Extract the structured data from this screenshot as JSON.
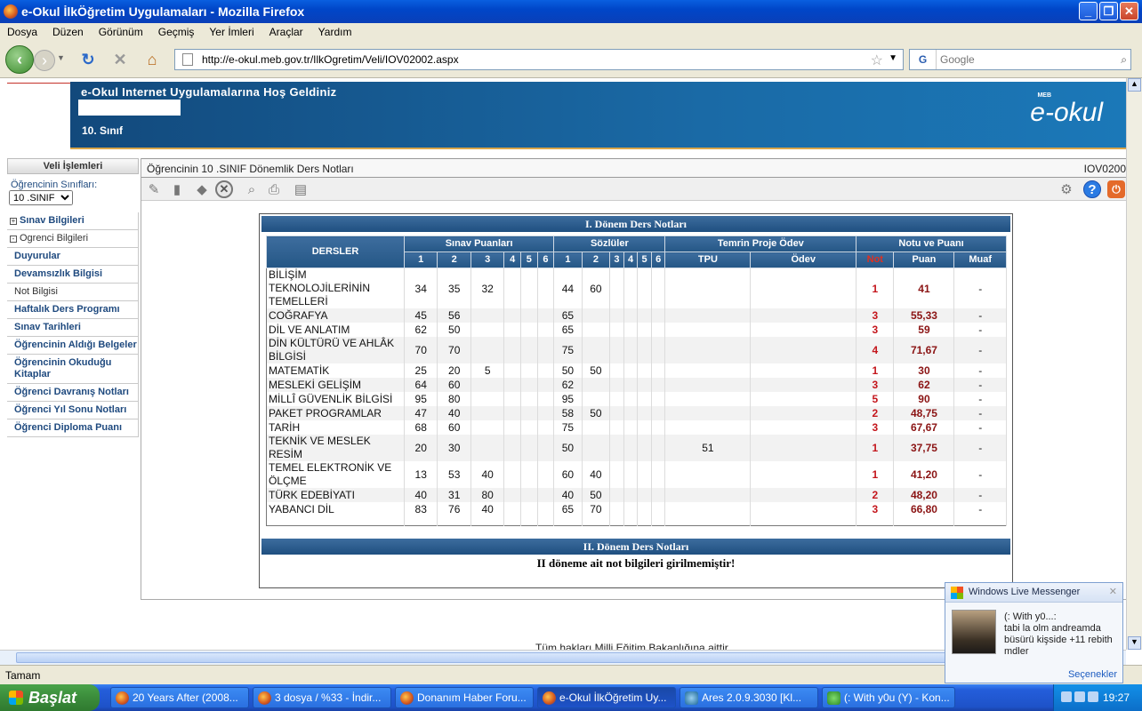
{
  "window": {
    "title": "e-Okul İlkÖğretim Uygulamaları - Mozilla Firefox"
  },
  "menu": [
    "Dosya",
    "Düzen",
    "Görünüm",
    "Geçmiş",
    "Yer İmleri",
    "Araçlar",
    "Yardım"
  ],
  "nav": {
    "url": "http://e-okul.meb.gov.tr/IlkOgretim/Veli/IOV02002.aspx",
    "search_placeholder": "Google",
    "search_engine": "G"
  },
  "banner": {
    "welcome": "e-Okul Internet Uygulamalarına Hoş Geldiniz",
    "grade": "10. Sınıf",
    "logo": "e-okul",
    "meb": "MEB"
  },
  "sidebar": {
    "header": "Veli İşlemleri",
    "class_label": "Öğrencinin Sınıfları:",
    "class_value": "10 .SINIF",
    "sections": [
      "Sınav Bilgileri",
      "Ogrenci Bilgileri"
    ],
    "items": [
      "Duyurular",
      "Devamsızlık Bilgisi",
      "Not Bilgisi",
      "Haftalık Ders Programı",
      "Sınav Tarihleri",
      "Öğrencinin Aldığı Belgeler",
      "Öğrencinin Okuduğu Kitaplar",
      "Öğrenci Davranış Notları",
      "Öğrenci Yıl Sonu Notları",
      "Öğrenci Diploma Puanı"
    ]
  },
  "panel": {
    "title": "Öğrencinin  10 .SINIF  Dönemlik Ders Notları",
    "code": "IOV0200"
  },
  "term1": {
    "title": "I. Dönem Ders Notları",
    "headers": {
      "subjects": "DERSLER",
      "exams": "Sınav Puanları",
      "oral": "Sözlüler",
      "project": "Temrin Proje Ödev",
      "grade": "Notu ve Puanı",
      "tpu": "TPU",
      "odev": "Ödev",
      "not": "Not",
      "puan": "Puan",
      "muaf": "Muaf"
    },
    "exam_cols": [
      "1",
      "2",
      "3",
      "4",
      "5",
      "6"
    ],
    "oral_cols": [
      "1",
      "2",
      "3",
      "4",
      "5",
      "6"
    ],
    "rows": [
      {
        "name": "BİLİŞİM TEKNOLOJİLERİNİN TEMELLERİ",
        "e": [
          "34",
          "35",
          "32",
          "",
          "",
          ""
        ],
        "o": [
          "44",
          "60",
          "",
          "",
          "",
          ""
        ],
        "tpu": "",
        "odev": "",
        "not": "1",
        "puan": "41",
        "muaf": "-"
      },
      {
        "name": "COĞRAFYA",
        "e": [
          "45",
          "56",
          "",
          "",
          "",
          ""
        ],
        "o": [
          "65",
          "",
          "",
          "",
          "",
          ""
        ],
        "tpu": "",
        "odev": "",
        "not": "3",
        "puan": "55,33",
        "muaf": "-"
      },
      {
        "name": "DİL VE ANLATIM",
        "e": [
          "62",
          "50",
          "",
          "",
          "",
          ""
        ],
        "o": [
          "65",
          "",
          "",
          "",
          "",
          ""
        ],
        "tpu": "",
        "odev": "",
        "not": "3",
        "puan": "59",
        "muaf": "-"
      },
      {
        "name": "DİN KÜLTÜRÜ VE AHLÂK BİLGİSİ",
        "e": [
          "70",
          "70",
          "",
          "",
          "",
          ""
        ],
        "o": [
          "75",
          "",
          "",
          "",
          "",
          ""
        ],
        "tpu": "",
        "odev": "",
        "not": "4",
        "puan": "71,67",
        "muaf": "-"
      },
      {
        "name": "MATEMATİK",
        "e": [
          "25",
          "20",
          "5",
          "",
          "",
          ""
        ],
        "o": [
          "50",
          "50",
          "",
          "",
          "",
          ""
        ],
        "tpu": "",
        "odev": "",
        "not": "1",
        "puan": "30",
        "muaf": "-"
      },
      {
        "name": "MESLEKİ GELİŞİM",
        "e": [
          "64",
          "60",
          "",
          "",
          "",
          ""
        ],
        "o": [
          "62",
          "",
          "",
          "",
          "",
          ""
        ],
        "tpu": "",
        "odev": "",
        "not": "3",
        "puan": "62",
        "muaf": "-"
      },
      {
        "name": "MİLLÎ GÜVENLİK BİLGİSİ",
        "e": [
          "95",
          "80",
          "",
          "",
          "",
          ""
        ],
        "o": [
          "95",
          "",
          "",
          "",
          "",
          ""
        ],
        "tpu": "",
        "odev": "",
        "not": "5",
        "puan": "90",
        "muaf": "-"
      },
      {
        "name": "PAKET PROGRAMLAR",
        "e": [
          "47",
          "40",
          "",
          "",
          "",
          ""
        ],
        "o": [
          "58",
          "50",
          "",
          "",
          "",
          ""
        ],
        "tpu": "",
        "odev": "",
        "not": "2",
        "puan": "48,75",
        "muaf": "-"
      },
      {
        "name": "TARİH",
        "e": [
          "68",
          "60",
          "",
          "",
          "",
          ""
        ],
        "o": [
          "75",
          "",
          "",
          "",
          "",
          ""
        ],
        "tpu": "",
        "odev": "",
        "not": "3",
        "puan": "67,67",
        "muaf": "-"
      },
      {
        "name": "TEKNİK VE MESLEK RESİM",
        "e": [
          "20",
          "30",
          "",
          "",
          "",
          ""
        ],
        "o": [
          "50",
          "",
          "",
          "",
          "",
          ""
        ],
        "tpu": "51",
        "odev": "",
        "not": "1",
        "puan": "37,75",
        "muaf": "-"
      },
      {
        "name": "TEMEL ELEKTRONİK VE ÖLÇME",
        "e": [
          "13",
          "53",
          "40",
          "",
          "",
          ""
        ],
        "o": [
          "60",
          "40",
          "",
          "",
          "",
          ""
        ],
        "tpu": "",
        "odev": "",
        "not": "1",
        "puan": "41,20",
        "muaf": "-"
      },
      {
        "name": "TÜRK EDEBİYATI",
        "e": [
          "40",
          "31",
          "80",
          "",
          "",
          ""
        ],
        "o": [
          "40",
          "50",
          "",
          "",
          "",
          ""
        ],
        "tpu": "",
        "odev": "",
        "not": "2",
        "puan": "48,20",
        "muaf": "-"
      },
      {
        "name": "YABANCI DİL",
        "e": [
          "83",
          "76",
          "40",
          "",
          "",
          ""
        ],
        "o": [
          "65",
          "70",
          "",
          "",
          "",
          ""
        ],
        "tpu": "",
        "odev": "",
        "not": "3",
        "puan": "66,80",
        "muaf": "-"
      }
    ]
  },
  "term2": {
    "title": "II. Dönem Ders Notları",
    "message": "II döneme ait not bilgileri girilmemiştir!"
  },
  "footer": "Tüm hakları Milli Eğitim Bakanlığına aittir",
  "status": "Tamam",
  "messenger": {
    "title": "Windows Live Messenger",
    "sender": "(: With y0...:",
    "message": "tabi la olm andreamda büsürü kişside +11 rebith mdler",
    "options": "Seçenekler"
  },
  "taskbar": {
    "start": "Başlat",
    "tasks": [
      {
        "label": "20 Years After (2008...",
        "icon": "firefox"
      },
      {
        "label": "3 dosya / %33 - İndir...",
        "icon": "firefox"
      },
      {
        "label": "Donanım Haber Foru...",
        "icon": "firefox"
      },
      {
        "label": "e-Okul İlkÖğretim Uy...",
        "icon": "firefox",
        "active": true
      },
      {
        "label": "Ares 2.0.9.3030   [Kl...",
        "icon": "ares"
      },
      {
        "label": "(: With y0u (Y) - Kon...",
        "icon": "messenger"
      }
    ],
    "clock": "19:27"
  }
}
